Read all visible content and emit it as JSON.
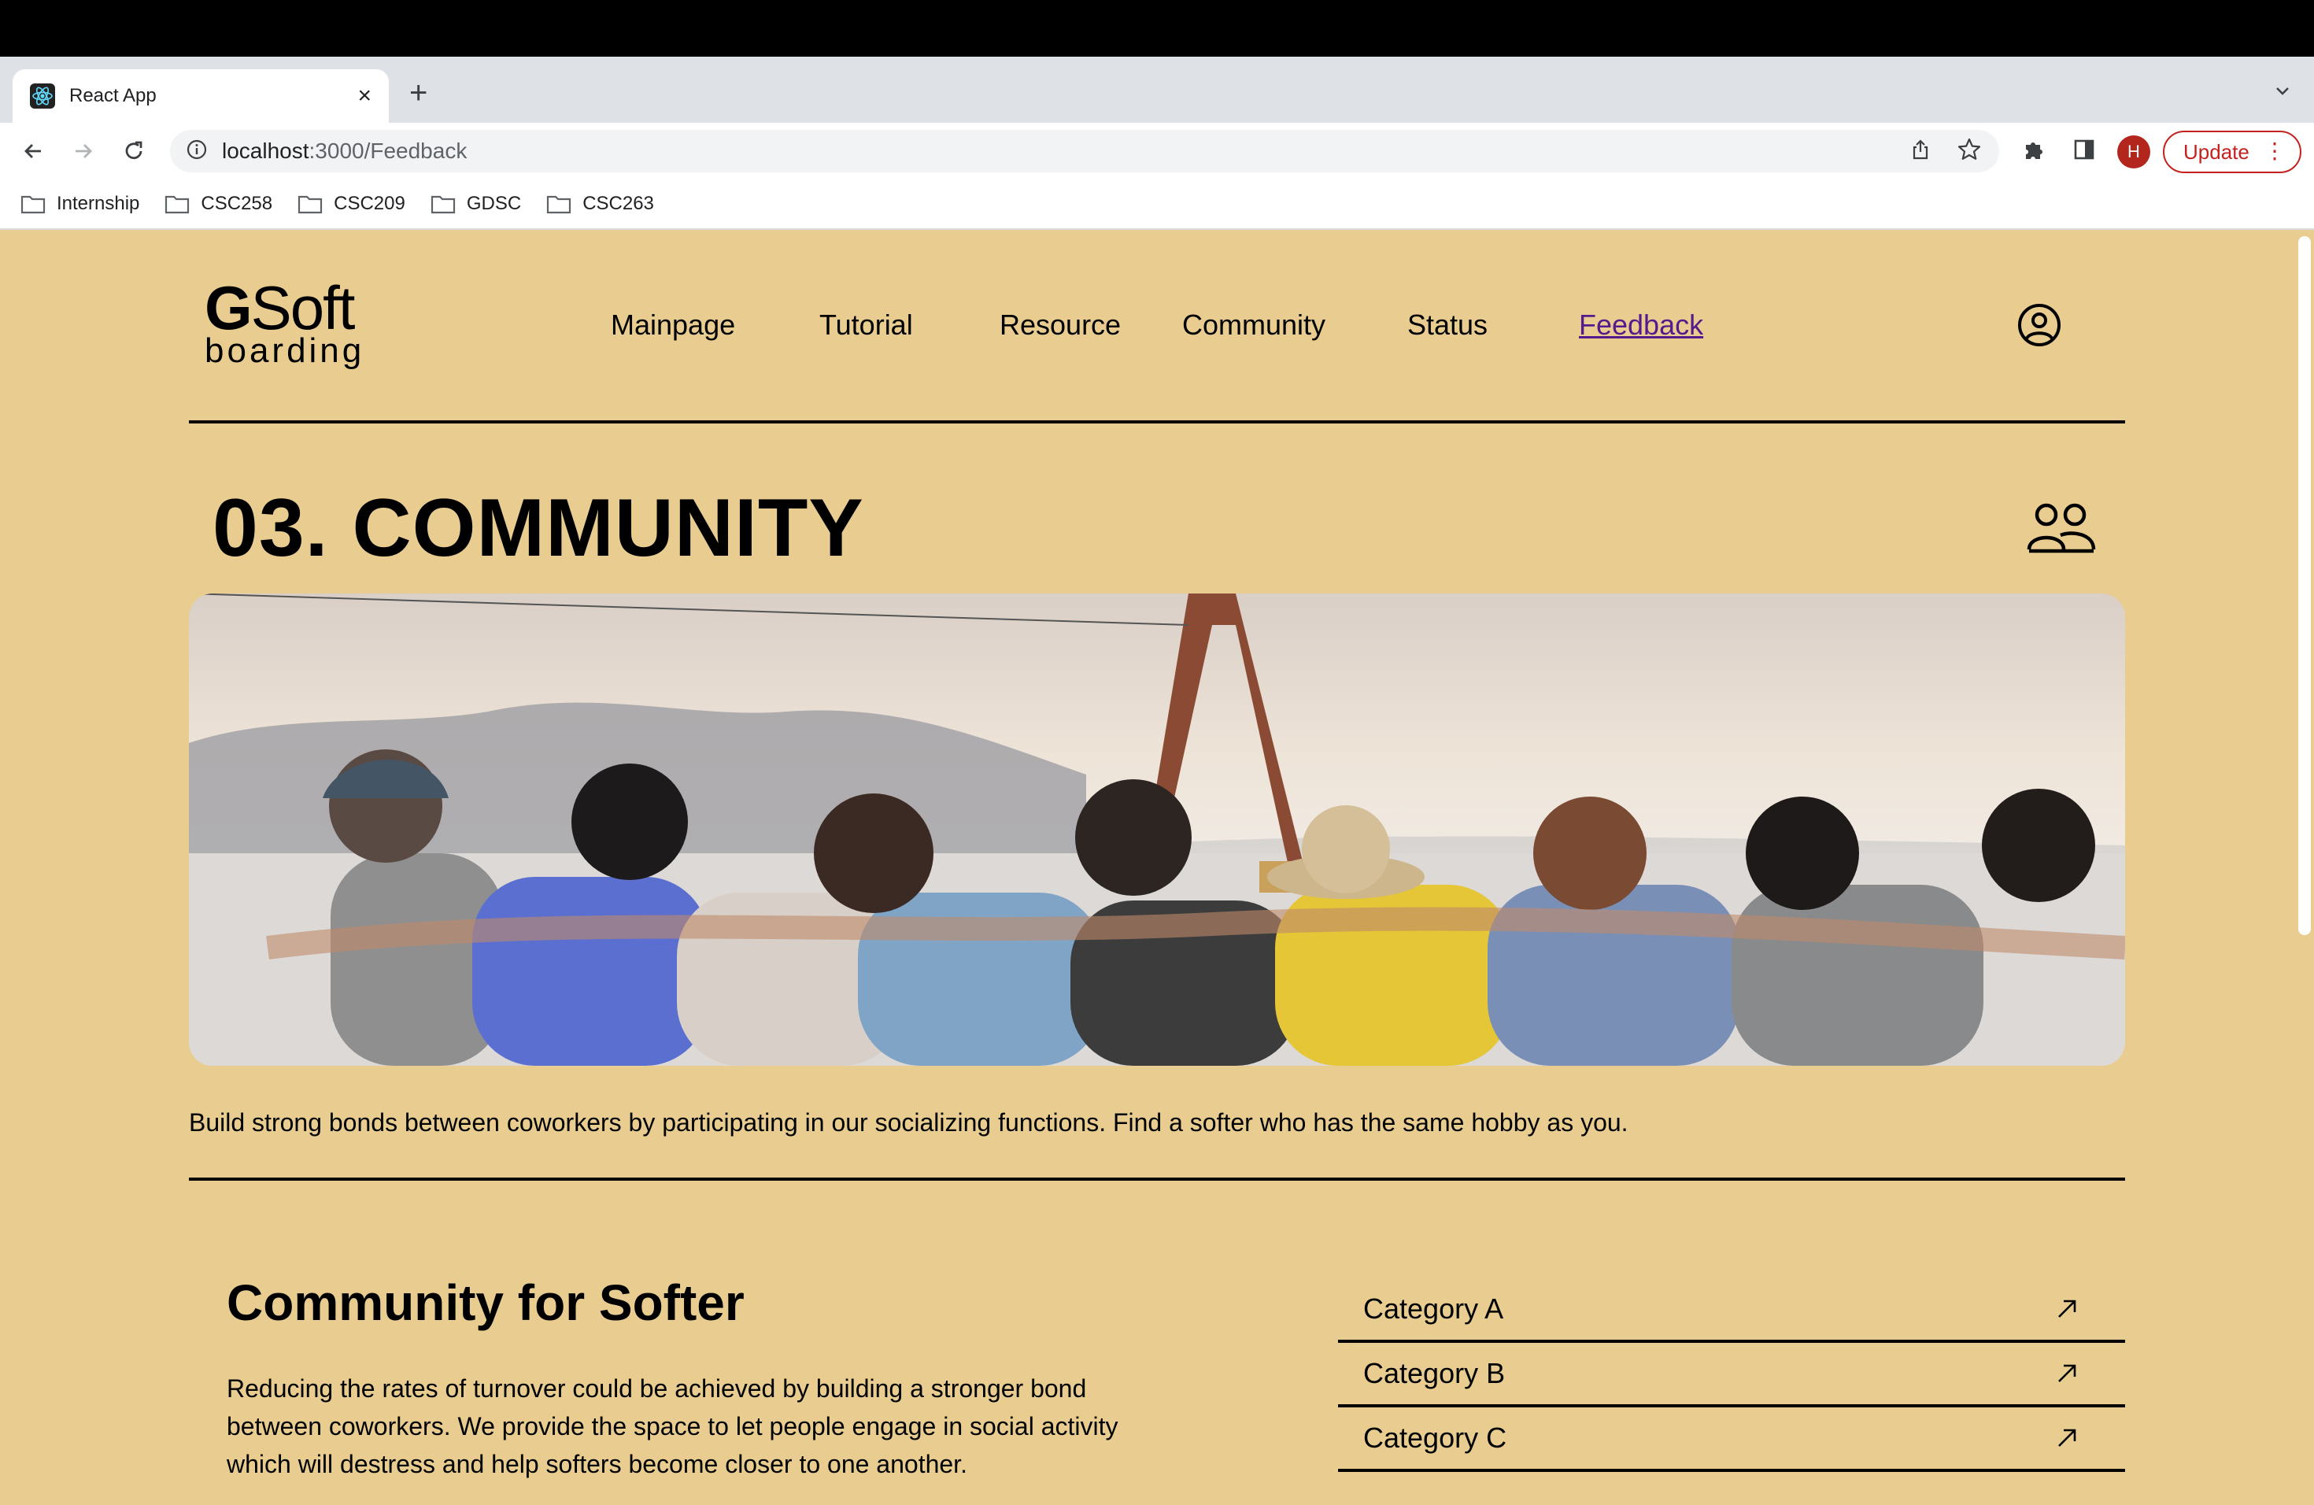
{
  "browser": {
    "tab_title": "React App",
    "url_host": "localhost",
    "url_path": ":3000/Feedback",
    "update_label": "Update",
    "avatar_letter": "H",
    "bookmarks": [
      "Internship",
      "CSC258",
      "CSC209",
      "GDSC",
      "CSC263"
    ]
  },
  "site": {
    "logo_top_g": "G",
    "logo_top_rest": "Soft",
    "logo_bottom": "boarding",
    "nav": [
      "Mainpage",
      "Tutorial",
      "Resource",
      "Community",
      "Status",
      "Feedback"
    ],
    "active_nav": "Feedback"
  },
  "section": {
    "heading": "03. COMMUNITY",
    "description": "Build strong bonds between coworkers by participating in our socializing functions. Find a softer who has the same hobby as you."
  },
  "community": {
    "title": "Community for Softer",
    "paragraph": "Reducing the rates of turnover could be achieved by building a stronger bond between coworkers. We provide the space to let people engage in social activity which will destress and help softers become closer to one another.",
    "categories": [
      "Category A",
      "Category B",
      "Category C"
    ]
  },
  "colors": {
    "page_bg": "#e9cc8f",
    "link_visited": "#551a8b",
    "update_red": "#c5221f"
  }
}
